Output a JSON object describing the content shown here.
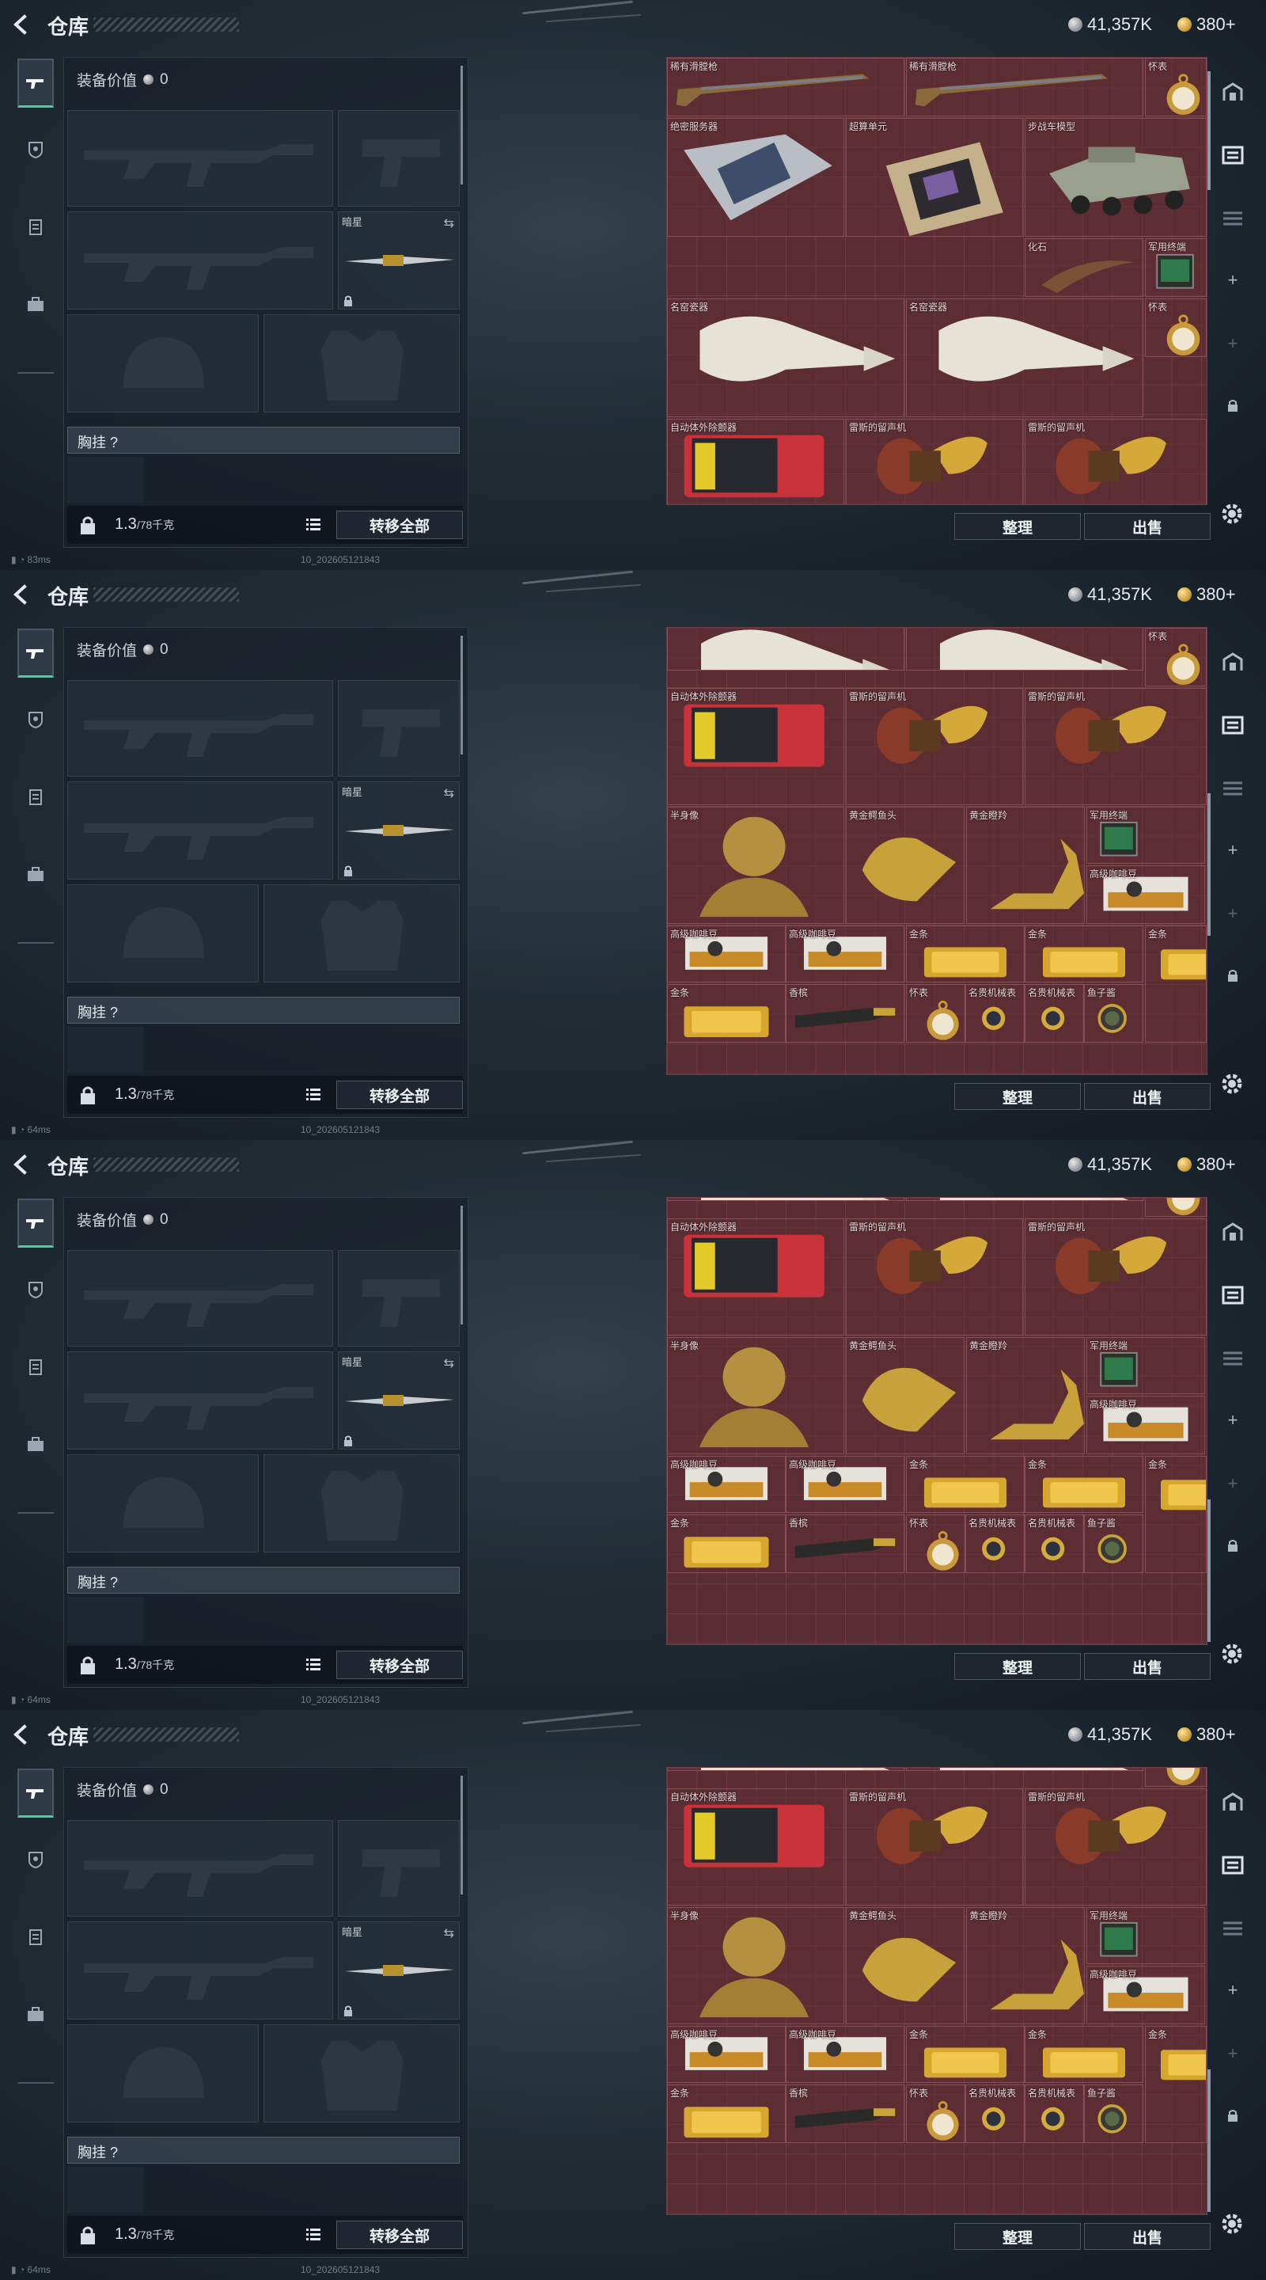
{
  "header": {
    "title": "仓库",
    "silver": "41,357K",
    "gold": "380+"
  },
  "equipment": {
    "value_label": "装备价值",
    "value": "0",
    "secondary_slot_label": "暗星",
    "chest_label": "胸挂 ?",
    "weight_value": "1.3",
    "weight_capacity": "/78千克",
    "transfer_all": "转移全部"
  },
  "storage": {
    "sort_button": "整理",
    "sell_button": "出售"
  },
  "panels": [
    {
      "footer_ping": "83ms",
      "footer_id": "10_202605121843",
      "items": [
        {
          "label": "稀有滑膛枪",
          "icon": "musket"
        },
        {
          "label": "稀有滑膛枪",
          "icon": "musket"
        },
        {
          "label": "怀表",
          "icon": "pocket-watch"
        },
        {
          "label": "绝密服务器",
          "icon": "server"
        },
        {
          "label": "超算单元",
          "icon": "cpu"
        },
        {
          "label": "步战车模型",
          "icon": "tank"
        },
        {
          "label": "化石",
          "icon": "fossil"
        },
        {
          "label": "军用终端",
          "icon": "terminal"
        },
        {
          "label": "名窑瓷器",
          "icon": "vase"
        },
        {
          "label": "名窑瓷器",
          "icon": "vase"
        },
        {
          "label": "怀表",
          "icon": "pocket-watch"
        },
        {
          "label": "自动体外除颤器",
          "icon": "aed"
        },
        {
          "label": "雷斯的留声机",
          "icon": "gramophone"
        },
        {
          "label": "雷斯的留声机",
          "icon": "gramophone"
        }
      ]
    },
    {
      "footer_ping": "64ms",
      "footer_id": "10_202605121843",
      "items": [
        {
          "label": "",
          "icon": "vase"
        },
        {
          "label": "",
          "icon": "vase"
        },
        {
          "label": "怀表",
          "icon": "pocket-watch"
        },
        {
          "label": "自动体外除颤器",
          "icon": "aed"
        },
        {
          "label": "雷斯的留声机",
          "icon": "gramophone"
        },
        {
          "label": "雷斯的留声机",
          "icon": "gramophone"
        },
        {
          "label": "半身像",
          "icon": "bust"
        },
        {
          "label": "黄金鳄鱼头",
          "icon": "croc-head"
        },
        {
          "label": "黄金瞪羚",
          "icon": "gazelle"
        },
        {
          "label": "军用终端",
          "icon": "terminal"
        },
        {
          "label": "高级咖啡豆",
          "icon": "coffee"
        },
        {
          "label": "高级咖啡豆",
          "icon": "coffee"
        },
        {
          "label": "高级咖啡豆",
          "icon": "coffee"
        },
        {
          "label": "金条",
          "icon": "gold-bar"
        },
        {
          "label": "金条",
          "icon": "gold-bar"
        },
        {
          "label": "金条",
          "icon": "gold-bar"
        },
        {
          "label": "金条",
          "icon": "gold-bar"
        },
        {
          "label": "香槟",
          "icon": "champagne"
        },
        {
          "label": "怀表",
          "icon": "pocket-watch"
        },
        {
          "label": "名贵机械表",
          "icon": "wristwatch"
        },
        {
          "label": "名贵机械表",
          "icon": "wristwatch"
        },
        {
          "label": "鱼子酱",
          "icon": "caviar"
        }
      ]
    },
    {
      "footer_ping": "64ms",
      "footer_id": "10_202605121843",
      "items": [
        {
          "label": "",
          "icon": "vase"
        },
        {
          "label": "",
          "icon": "vase"
        },
        {
          "label": "",
          "icon": "pocket-watch"
        },
        {
          "label": "自动体外除颤器",
          "icon": "aed"
        },
        {
          "label": "雷斯的留声机",
          "icon": "gramophone"
        },
        {
          "label": "雷斯的留声机",
          "icon": "gramophone"
        },
        {
          "label": "半身像",
          "icon": "bust"
        },
        {
          "label": "黄金鳄鱼头",
          "icon": "croc-head"
        },
        {
          "label": "黄金瞪羚",
          "icon": "gazelle"
        },
        {
          "label": "军用终端",
          "icon": "terminal"
        },
        {
          "label": "高级咖啡豆",
          "icon": "coffee"
        },
        {
          "label": "高级咖啡豆",
          "icon": "coffee"
        },
        {
          "label": "高级咖啡豆",
          "icon": "coffee"
        },
        {
          "label": "金条",
          "icon": "gold-bar"
        },
        {
          "label": "金条",
          "icon": "gold-bar"
        },
        {
          "label": "金条",
          "icon": "gold-bar"
        },
        {
          "label": "金条",
          "icon": "gold-bar"
        },
        {
          "label": "香槟",
          "icon": "champagne"
        },
        {
          "label": "怀表",
          "icon": "pocket-watch"
        },
        {
          "label": "名贵机械表",
          "icon": "wristwatch"
        },
        {
          "label": "名贵机械表",
          "icon": "wristwatch"
        },
        {
          "label": "鱼子酱",
          "icon": "caviar"
        }
      ]
    },
    {
      "footer_ping": "64ms",
      "footer_id": "10_202605121843",
      "items": [
        {
          "label": "",
          "icon": "vase"
        },
        {
          "label": "",
          "icon": "vase"
        },
        {
          "label": "",
          "icon": "pocket-watch"
        },
        {
          "label": "自动体外除颤器",
          "icon": "aed"
        },
        {
          "label": "雷斯的留声机",
          "icon": "gramophone"
        },
        {
          "label": "雷斯的留声机",
          "icon": "gramophone"
        },
        {
          "label": "半身像",
          "icon": "bust"
        },
        {
          "label": "黄金鳄鱼头",
          "icon": "croc-head"
        },
        {
          "label": "黄金瞪羚",
          "icon": "gazelle"
        },
        {
          "label": "军用终端",
          "icon": "terminal"
        },
        {
          "label": "高级咖啡豆",
          "icon": "coffee"
        },
        {
          "label": "高级咖啡豆",
          "icon": "coffee"
        },
        {
          "label": "高级咖啡豆",
          "icon": "coffee"
        },
        {
          "label": "金条",
          "icon": "gold-bar"
        },
        {
          "label": "金条",
          "icon": "gold-bar"
        },
        {
          "label": "金条",
          "icon": "gold-bar"
        },
        {
          "label": "金条",
          "icon": "gold-bar"
        },
        {
          "label": "香槟",
          "icon": "champagne"
        },
        {
          "label": "怀表",
          "icon": "pocket-watch"
        },
        {
          "label": "名贵机械表",
          "icon": "wristwatch"
        },
        {
          "label": "名贵机械表",
          "icon": "wristwatch"
        },
        {
          "label": "鱼子酱",
          "icon": "caviar"
        }
      ]
    }
  ]
}
